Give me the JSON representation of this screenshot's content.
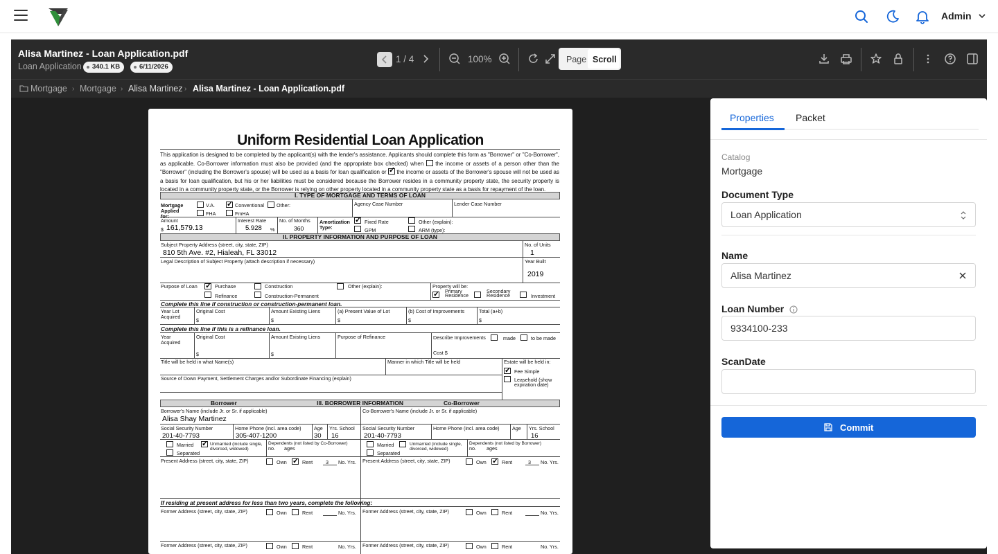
{
  "user": {
    "name": "Admin"
  },
  "viewer": {
    "title": "Alisa Martinez - Loan Application.pdf",
    "subtitle": "Loan Application",
    "size_badge": "340.1 KB",
    "date_badge": "6/11/2026",
    "page_indicator": "1 / 4",
    "zoom": "100%",
    "mode_page": "Page",
    "mode_scroll": "Scroll"
  },
  "breadcrumb": [
    "Mortgage",
    "Mortgage",
    "Alisa Martinez",
    "Alisa Martinez - Loan Application.pdf"
  ],
  "panel": {
    "tabs": [
      "Properties",
      "Packet"
    ],
    "catalog_label": "Catalog",
    "catalog_value": "Mortgage",
    "doctype_label": "Document Type",
    "doctype_value": "Loan Application",
    "name_label": "Name",
    "name_value": "Alisa Martinez",
    "loan_label": "Loan Number",
    "loan_value": "9334100-233",
    "scandate_label": "ScanDate",
    "scandate_value": "",
    "commit_label": "Commit"
  },
  "colors": {
    "accent": "#1566d9"
  },
  "document": {
    "title": "Uniform Residential Loan Application",
    "para1": "This application is designed to be completed by the applicant(s) with the lender's assistance. Applicants should complete this form as \"Borrower\" or \"Co-Borrower\", as applicable. Co-Borrower information must also be provided (and the appropriate box checked) when",
    "para2": "the income or assets of a person other than the \"Borrower\" (including the Borrower's spouse) will be used as a basis for loan qualification or",
    "para3": "the income or assets of the Borrower's spouse will not be used as a basis for loan qualification, but his or her liabilities must be considered because the  Borrower resides in a community property state, the security property is located in a community property state, or the Borrower is relying on other property located in a community property state as a basis for repayment of the loan.",
    "sec1": "I. TYPE OF MORTGAGE AND TERMS OF LOAN",
    "sec2": "II. PROPERTY INFORMATION AND PURPOSE OF LOAN",
    "sec3_left": "Borrower",
    "sec3": "III. BORROWER INFORMATION",
    "sec3_right": "Co-Borrower",
    "mortgage_applied": "Mortgage Applied for:",
    "va": "V.A.",
    "conventional": "Conventional",
    "other": "Other:",
    "fha": "FHA",
    "fmha": "FmHA",
    "agency_case": "Agency Case Number",
    "lender_case": "Lender Case Number",
    "amount_label": "Amount",
    "dollar": "$",
    "amount": "161,579.13",
    "interest_label": "Interest Rate",
    "interest": "5.928",
    "pct": "%",
    "months_label": "No. of Months",
    "months": "360",
    "amort_label": "Amortization Type:",
    "fixed": "Fixed Rate",
    "gpm": "GPM",
    "other_explain": "Other (explain):",
    "arm": "ARM (type):",
    "subject_addr_label": "Subject Property Address (street, city, state, ZIP)",
    "subject_addr": "810 5th Ave. #2, Hialeah, FL 33012",
    "units_label": "No. of Units",
    "units": "1",
    "legal_desc": "Legal Description of Subject Property (attach description if necessary)",
    "year_built_label": "Year Built",
    "year_built": "2019",
    "purpose_label": "Purpose of Loan",
    "purchase": "Purchase",
    "construction": "Construction",
    "other_explain2": "Other (explain):",
    "refinance": "Refinance",
    "constr_perm": "Construction-Permanent",
    "prop_will_be": "Property will be:",
    "primary": "Primary Residence",
    "secondary": "Secondary Residence",
    "investment": "Investment",
    "constr_line": "Complete this line if construction or construction-permanent loan.",
    "year_lot": "Year Lot Acquired",
    "orig_cost": "Original Cost",
    "amt_liens": "Amount Existing Liens",
    "present_value": "(a) Present Value of Lot",
    "cost_impr": "(b) Cost of Improvements",
    "total": "Total (a+b)",
    "refi_line": "Complete this line if this is a refinance loan.",
    "year_acq": "Year Acquired",
    "purpose_refi": "Purpose of Refinance",
    "describe_impr": "Describe Improvements",
    "made": "made",
    "to_be_made": "to be made",
    "cost": "Cost  $",
    "title_names": "Title will be held in what Name(s)",
    "manner": "Manner in which Title will be held",
    "estate": "Estate will be held in:",
    "fee_simple": "Fee Simple",
    "leasehold": "Leasehold (show expiration date)",
    "source_down": "Source of Down Payment, Settlement Charges and/or Subordinate Financing (explain)",
    "b_name_label": "Borrower's Name (include Jr. or Sr. if applicable)",
    "b_name": "Alisa Shay Martinez",
    "cb_name_label": "Co-Borrower's Name (include Jr. or Sr. if applicable)",
    "ssn_label": "Social Security Number",
    "home_phone_label": "Home Phone (incl. area code)",
    "age_label": "Age",
    "yrs_school_label": "Yrs. School",
    "b_ssn": "201-40-7793",
    "b_phone": "305-407-1200",
    "b_age": "30",
    "b_school": "16",
    "cb_ssn": "201-40-7793",
    "cb_school": "16",
    "married": "Married",
    "unmarried": "Unmarried (include single, divorced, widowed)",
    "separated": "Separated",
    "dependents_cb": "Dependents (not listed by Co-Borrower)",
    "dependents_b": "Dependents (not listed by Borrower)",
    "no": "no.",
    "ages": "ages",
    "present_addr": "Present Address (street, city, state, ZIP)",
    "own": "Own",
    "rent": "Rent",
    "no_yrs": "No. Yrs.",
    "yrs_val": "3",
    "residing_line": "If residing at present address for less than two years, complete the following:",
    "former_addr": "Former Address (street, city, state, ZIP)"
  }
}
